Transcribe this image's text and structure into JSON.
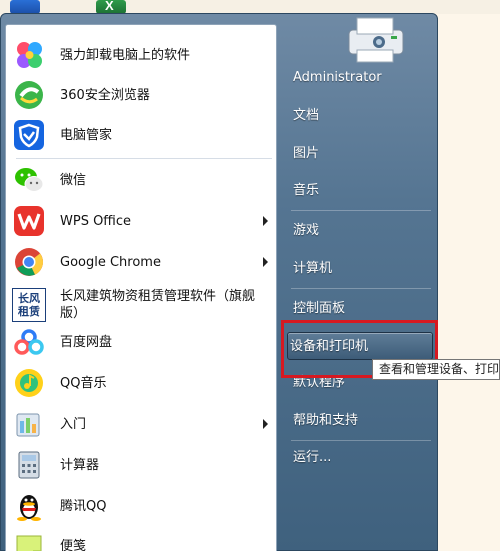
{
  "desktop": {
    "icons": [
      "mail-icon",
      "excel-icon"
    ]
  },
  "programs": [
    {
      "label": "强力卸载电脑上的软件",
      "icon": "clover-icon",
      "has_submenu": false
    },
    {
      "label": "360安全浏览器",
      "icon": "360-browser-icon",
      "has_submenu": false
    },
    {
      "label": "电脑管家",
      "icon": "shield-icon",
      "has_submenu": false
    },
    {
      "label": "微信",
      "icon": "wechat-icon",
      "has_submenu": false
    },
    {
      "label": "WPS Office",
      "icon": "wps-icon",
      "has_submenu": true
    },
    {
      "label": "Google Chrome",
      "icon": "chrome-icon",
      "has_submenu": true
    },
    {
      "label": "长风建筑物资租赁管理软件（旗舰版）",
      "icon_text": "长风租赁",
      "icon": "changfeng-icon",
      "has_submenu": false
    },
    {
      "label": "百度网盘",
      "icon": "baidu-netdisk-icon",
      "has_submenu": false
    },
    {
      "label": "QQ音乐",
      "icon": "qq-music-icon",
      "has_submenu": false
    },
    {
      "label": "入门",
      "icon": "getting-started-icon",
      "has_submenu": true
    },
    {
      "label": "计算器",
      "icon": "calculator-icon",
      "has_submenu": false
    },
    {
      "label": "腾讯QQ",
      "icon": "qq-penguin-icon",
      "has_submenu": false
    },
    {
      "label": "便笺",
      "icon": "sticky-notes-icon",
      "has_submenu": false
    }
  ],
  "right_menu": {
    "user": "Administrator",
    "items": [
      "文档",
      "图片",
      "音乐",
      "游戏",
      "计算机",
      "控制面板",
      "设备和打印机",
      "默认程序",
      "帮助和支持",
      "运行..."
    ],
    "highlighted": "设备和打印机"
  },
  "tooltip": "查看和管理设备、打印",
  "colors": {
    "menu_blue": "#557592",
    "highlight_red": "#d71921",
    "tooltip_bg": "#ffffff"
  }
}
